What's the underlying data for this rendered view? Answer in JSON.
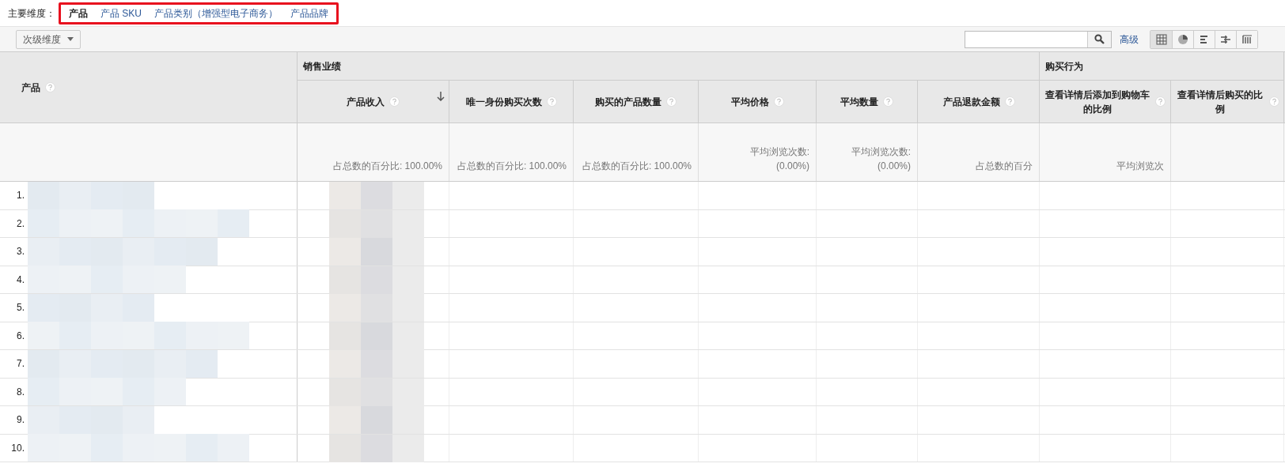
{
  "primary_dimension": {
    "label": "主要维度：",
    "options": [
      {
        "label": "产品",
        "selected": true
      },
      {
        "label": "产品 SKU",
        "selected": false
      },
      {
        "label": "产品类别（增强型电子商务）",
        "selected": false
      },
      {
        "label": "产品品牌",
        "selected": false
      }
    ]
  },
  "secondary_dimension": {
    "label": "次级维度"
  },
  "advanced_link": "高级",
  "view_buttons": [
    {
      "kind": "table",
      "selected": true
    },
    {
      "kind": "pie",
      "selected": false
    },
    {
      "kind": "bar",
      "selected": false
    },
    {
      "kind": "compare",
      "selected": false
    },
    {
      "kind": "pivot",
      "selected": false
    }
  ],
  "table": {
    "first_column": {
      "label": "产品"
    },
    "groups": [
      {
        "label": "销售业绩",
        "columns": [
          {
            "label": "产品收入",
            "sorted": true
          },
          {
            "label": "唯一身份购买次数",
            "sorted": false
          },
          {
            "label": "购买的产品数量",
            "sorted": false
          },
          {
            "label": "平均价格",
            "sorted": false
          },
          {
            "label": "平均数量",
            "sorted": false
          },
          {
            "label": "产品退款金额",
            "sorted": false
          }
        ]
      },
      {
        "label": "购买行为",
        "columns": [
          {
            "label": "查看详情后添加到购物车的比例",
            "sorted": false
          },
          {
            "label": "查看详情后购买的比例",
            "sorted": false
          }
        ]
      }
    ],
    "summary": [
      [
        "占总数的百分比: 100.00%"
      ],
      [
        "占总数的百分比: 100.00%"
      ],
      [
        "占总数的百分比: 100.00%"
      ],
      [
        "平均浏览次数:",
        "(0.00%)"
      ],
      [
        "平均浏览次数:",
        "(0.00%)"
      ],
      [
        "占总数的百分"
      ],
      [
        "平均浏览次"
      ]
    ],
    "rows": [
      "1.",
      "2.",
      "3.",
      "4.",
      "5.",
      "6.",
      "7.",
      "8.",
      "9.",
      "10."
    ]
  }
}
